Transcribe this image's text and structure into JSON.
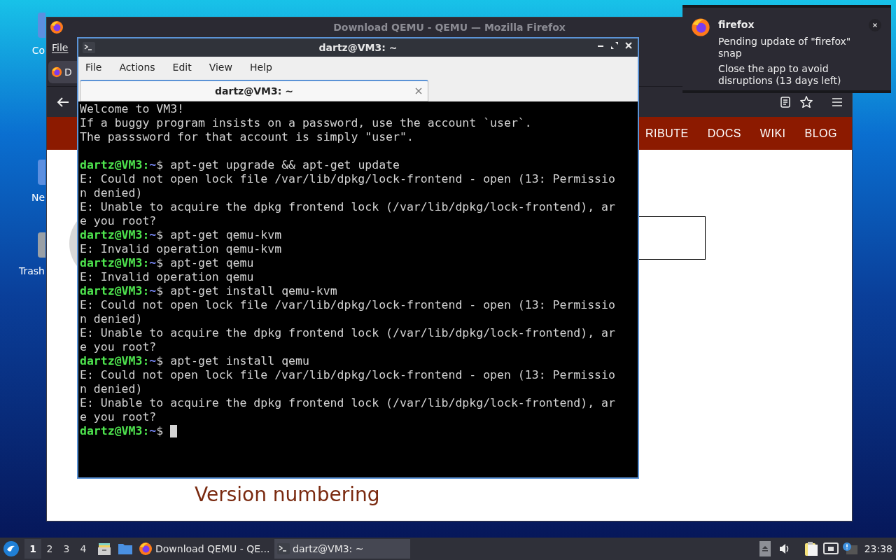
{
  "desktop": {
    "icons": [
      {
        "label": "Co"
      },
      {
        "label": "Ne"
      },
      {
        "label": "Trash"
      }
    ]
  },
  "browser": {
    "title": "Download QEMU - QEMU — Mozilla Firefox",
    "menu": [
      "File"
    ],
    "tabs": [
      {
        "label": "D",
        "selected": true
      }
    ],
    "site_nav": [
      "RIBUTE",
      "DOCS",
      "WIKI",
      "BLOG"
    ],
    "heading": "Version numbering"
  },
  "terminal": {
    "title": "dartz@VM3: ~",
    "menu": [
      "File",
      "Actions",
      "Edit",
      "View",
      "Help"
    ],
    "tabs": [
      {
        "label": "dartz@VM3: ~",
        "selected": true
      }
    ],
    "lines": [
      {
        "kind": "output",
        "text": "Welcome to VM3!"
      },
      {
        "kind": "output",
        "text": "If a buggy program insists on a password, use the account `user`."
      },
      {
        "kind": "output",
        "text": "The passsword for that account is simply \"user\"."
      },
      {
        "kind": "blank"
      },
      {
        "kind": "prompt",
        "user": "dartz@VM3",
        "sep": ":",
        "path": "~",
        "symbol": "$",
        "command": "apt-get upgrade && apt-get update"
      },
      {
        "kind": "output",
        "text": "E: Could not open lock file /var/lib/dpkg/lock-frontend - open (13: Permissio"
      },
      {
        "kind": "output",
        "text": "n denied)"
      },
      {
        "kind": "output",
        "text": "E: Unable to acquire the dpkg frontend lock (/var/lib/dpkg/lock-frontend), ar"
      },
      {
        "kind": "output",
        "text": "e you root?"
      },
      {
        "kind": "prompt",
        "user": "dartz@VM3",
        "sep": ":",
        "path": "~",
        "symbol": "$",
        "command": "apt-get qemu-kvm"
      },
      {
        "kind": "output",
        "text": "E: Invalid operation qemu-kvm"
      },
      {
        "kind": "prompt",
        "user": "dartz@VM3",
        "sep": ":",
        "path": "~",
        "symbol": "$",
        "command": "apt-get qemu"
      },
      {
        "kind": "output",
        "text": "E: Invalid operation qemu"
      },
      {
        "kind": "prompt",
        "user": "dartz@VM3",
        "sep": ":",
        "path": "~",
        "symbol": "$",
        "command": "apt-get install qemu-kvm"
      },
      {
        "kind": "output",
        "text": "E: Could not open lock file /var/lib/dpkg/lock-frontend - open (13: Permissio"
      },
      {
        "kind": "output",
        "text": "n denied)"
      },
      {
        "kind": "output",
        "text": "E: Unable to acquire the dpkg frontend lock (/var/lib/dpkg/lock-frontend), ar"
      },
      {
        "kind": "output",
        "text": "e you root?"
      },
      {
        "kind": "prompt",
        "user": "dartz@VM3",
        "sep": ":",
        "path": "~",
        "symbol": "$",
        "command": "apt-get install qemu"
      },
      {
        "kind": "output",
        "text": "E: Could not open lock file /var/lib/dpkg/lock-frontend - open (13: Permissio"
      },
      {
        "kind": "output",
        "text": "n denied)"
      },
      {
        "kind": "output",
        "text": "E: Unable to acquire the dpkg frontend lock (/var/lib/dpkg/lock-frontend), ar"
      },
      {
        "kind": "output",
        "text": "e you root?"
      },
      {
        "kind": "prompt",
        "user": "dartz@VM3",
        "sep": ":",
        "path": "~",
        "symbol": "$",
        "cursor": true
      }
    ]
  },
  "notification": {
    "app": "firefox",
    "title": "Pending update of \"firefox\" snap",
    "body": "Close the app to avoid disruptions (13 days left)"
  },
  "taskbar": {
    "workspaces": [
      {
        "label": "1",
        "selected": true
      },
      {
        "label": "2",
        "selected": false
      },
      {
        "label": "3",
        "selected": false
      },
      {
        "label": "4",
        "selected": false
      }
    ],
    "tasks": [
      {
        "kind": "browser",
        "label": "Download QEMU - QE...",
        "selected": false
      },
      {
        "kind": "terminal",
        "label": "dartz@VM3: ~",
        "selected": true
      }
    ],
    "clock": "23:38"
  }
}
